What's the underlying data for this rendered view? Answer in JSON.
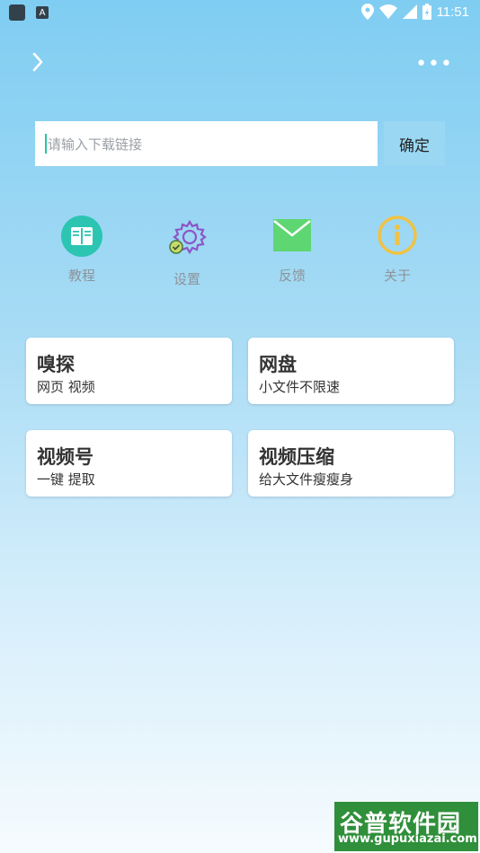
{
  "status": {
    "time": "11:51",
    "a_badge": "A"
  },
  "search": {
    "placeholder": "请输入下载链接",
    "confirm_label": "确定"
  },
  "shortcuts": [
    {
      "label": "教程",
      "icon": "book-icon",
      "color": "#2bc5b2"
    },
    {
      "label": "设置",
      "icon": "gear-icon",
      "color": "#8e55c7"
    },
    {
      "label": "反馈",
      "icon": "mail-icon",
      "color": "#5ed672"
    },
    {
      "label": "关于",
      "icon": "info-icon",
      "color": "#f0c245"
    }
  ],
  "cards": [
    {
      "title": "嗅探",
      "subtitle": "网页 视频"
    },
    {
      "title": "网盘",
      "subtitle": "小文件不限速"
    },
    {
      "title": "视频号",
      "subtitle": "一键 提取"
    },
    {
      "title": "视频压缩",
      "subtitle": "给大文件瘦瘦身"
    }
  ],
  "watermark": {
    "line1": "谷普软件园",
    "line2": "www.gupuxiazai.com"
  }
}
